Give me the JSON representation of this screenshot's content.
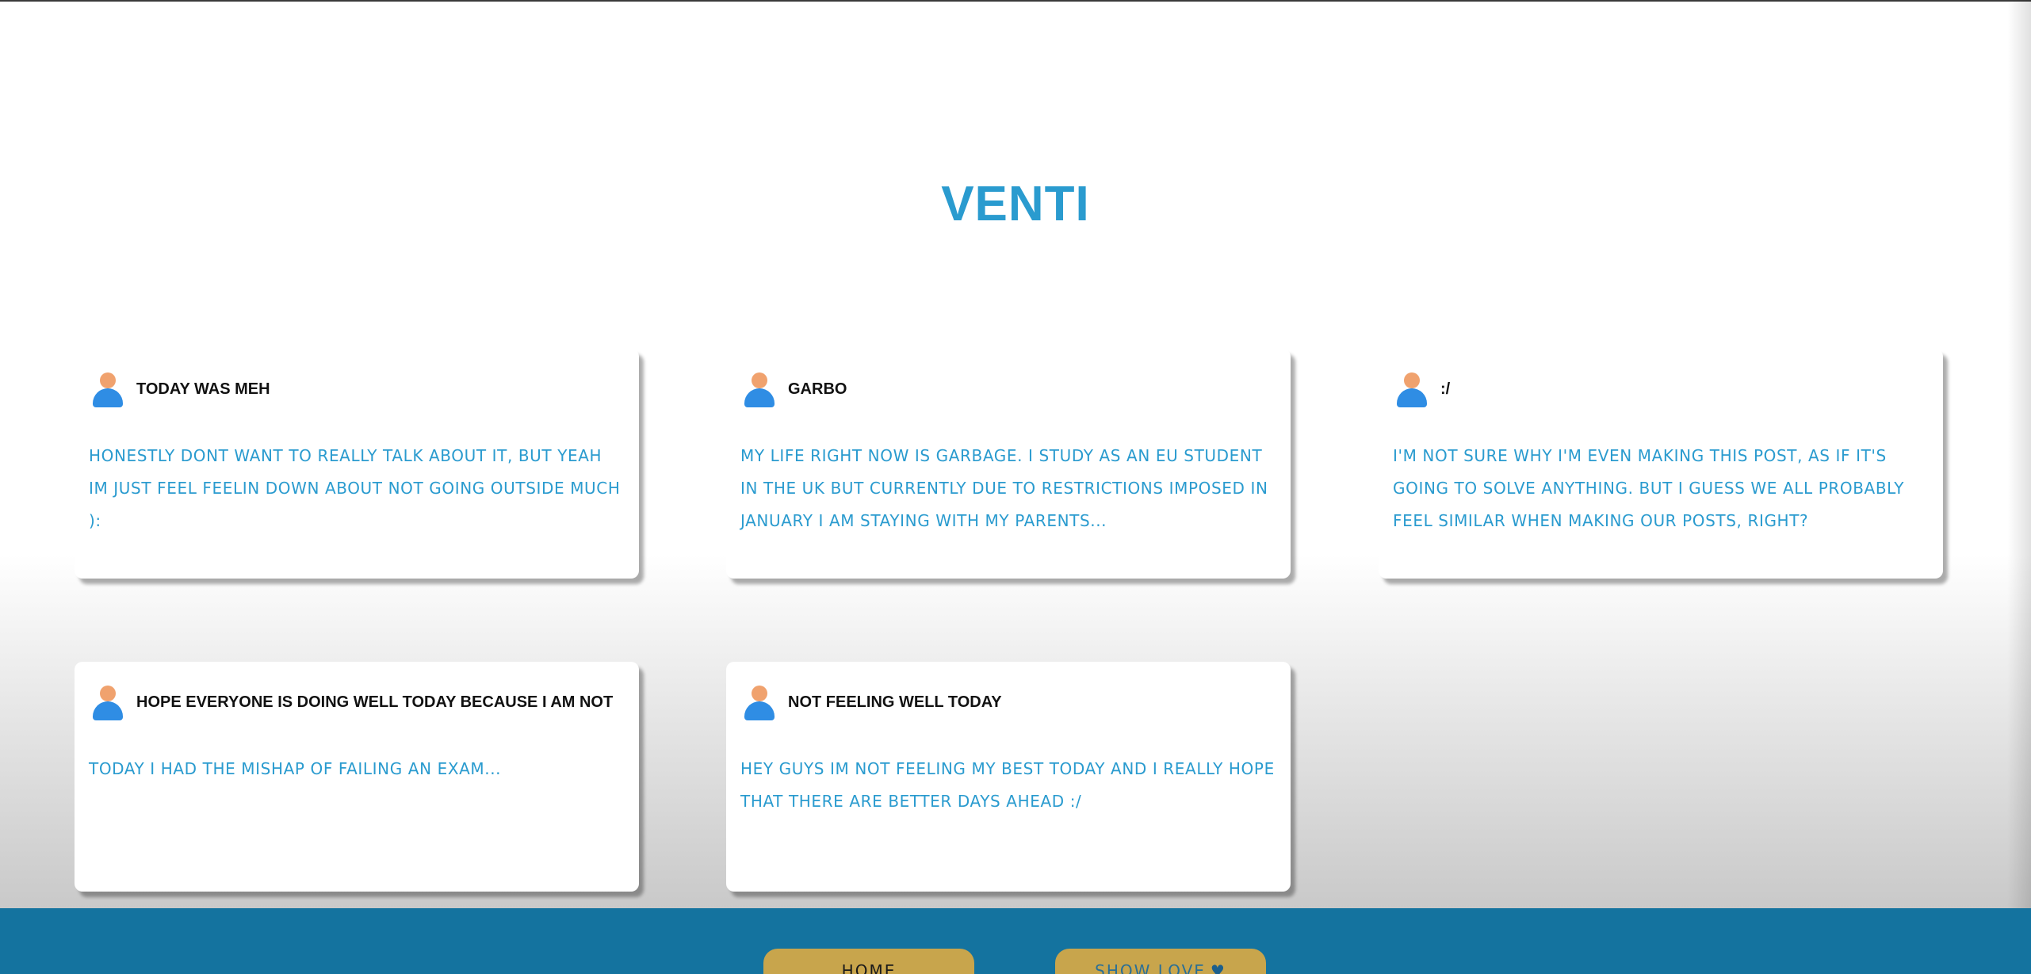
{
  "site": {
    "title": "VENTI"
  },
  "posts": [
    {
      "title": "TODAY WAS MEH",
      "body": "HONESTLY DONT WANT TO REALLY TALK ABOUT IT, BUT YEAH IM JUST FEEL FEELIN DOWN ABOUT NOT GOING OUTSIDE MUCH ):"
    },
    {
      "title": "GARBO",
      "body": "MY LIFE RIGHT NOW IS GARBAGE. I STUDY AS AN EU STUDENT IN THE UK BUT CURRENTLY DUE TO RESTRICTIONS IMPOSED IN JANUARY I AM STAYING WITH MY PARENTS..."
    },
    {
      "title": ":/",
      "body": "I'M NOT SURE WHY I'M EVEN MAKING THIS POST, AS IF IT'S GOING TO SOLVE ANYTHING. BUT I GUESS WE ALL PROBABLY FEEL SIMILAR WHEN MAKING OUR POSTS, RIGHT?"
    },
    {
      "title": "HOPE EVERYONE IS DOING WELL TODAY BECAUSE I AM NOT",
      "body": "TODAY I HAD THE MISHAP OF FAILING AN EXAM..."
    },
    {
      "title": "NOT FEELING WELL TODAY",
      "body": "HEY GUYS IM NOT FEELING MY BEST TODAY AND I REALLY HOPE THAT THERE ARE BETTER DAYS AHEAD :/"
    }
  ],
  "footer": {
    "home_label": "HOME",
    "love_label": "SHOW LOVE",
    "love_icon": "heart-icon"
  },
  "colors": {
    "accent": "#2a9bcf",
    "footer": "#14739f",
    "button": "#c8a54c"
  }
}
